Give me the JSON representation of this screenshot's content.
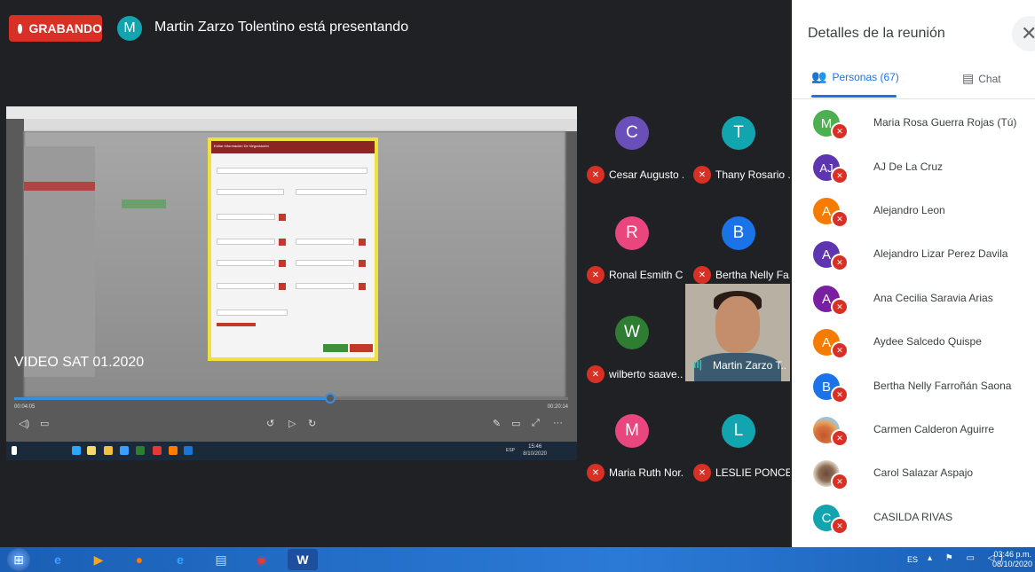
{
  "meeting": {
    "recording_label": "GRABANDO",
    "presenter_initial": "M",
    "presenter_status": "Martin Zarzo Tolentino está presentando"
  },
  "shared_screen": {
    "video_title": "VIDEO SAT 01.2020",
    "modal_title": "Editar Información De Negociación",
    "time_current": "00:04:05",
    "time_total": "00:20:14",
    "progress": 0.57,
    "taskbar_lang": "ESP",
    "taskbar_time": "15:46",
    "taskbar_date": "8/10/2020"
  },
  "participants": [
    {
      "initial": "C",
      "name": "Cesar Augusto ...",
      "color": "#6b4fb8"
    },
    {
      "initial": "T",
      "name": "Thany Rosario ...",
      "color": "#12a4af"
    },
    {
      "initial": "R",
      "name": "Ronal Esmith C...",
      "color": "#e8467c"
    },
    {
      "initial": "B",
      "name": "Bertha Nelly Fa...",
      "color": "#1a73e8"
    },
    {
      "initial": "W",
      "name": "wilberto saave...",
      "color": "#2e7d32"
    },
    {
      "initial": "",
      "name": "Martin Zarzo T...",
      "color": ""
    },
    {
      "initial": "M",
      "name": "Maria Ruth Nor...",
      "color": "#e8467c"
    },
    {
      "initial": "L",
      "name": "LESLIE PONCE...",
      "color": "#12a4af"
    }
  ],
  "panel": {
    "title": "Detalles de la reunión",
    "tab_people": "Personas (67)",
    "tab_chat": "Chat",
    "people": [
      {
        "initial": "M",
        "name": "Maria Rosa Guerra Rojas (Tú)",
        "color": "#4caf50",
        "photo": ""
      },
      {
        "initial": "AJ",
        "name": "AJ De La Cruz",
        "color": "#5e35b1",
        "photo": ""
      },
      {
        "initial": "A",
        "name": "Alejandro Leon",
        "color": "#f57c00",
        "photo": ""
      },
      {
        "initial": "A",
        "name": "Alejandro Lizar Perez Davila",
        "color": "#5e35b1",
        "photo": ""
      },
      {
        "initial": "A",
        "name": "Ana Cecilia Saravia Arias",
        "color": "#7b1fa2",
        "photo": ""
      },
      {
        "initial": "A",
        "name": "Aydee Salcedo Quispe",
        "color": "#f57c00",
        "photo": ""
      },
      {
        "initial": "B",
        "name": "Bertha Nelly Farroñán Saona",
        "color": "#1a73e8",
        "photo": ""
      },
      {
        "initial": "",
        "name": "Carmen Calderon Aguirre",
        "color": "",
        "photo": "rock"
      },
      {
        "initial": "",
        "name": "Carol Salazar Aspajo",
        "color": "",
        "photo": "face"
      },
      {
        "initial": "C",
        "name": "CASILDA RIVAS",
        "color": "#12a4af",
        "photo": ""
      }
    ]
  },
  "taskbar": {
    "lang": "ES",
    "time": "03:46 p.m.",
    "date": "08/10/2020",
    "apps": [
      {
        "icon": "internet-explorer-icon",
        "glyph": "e",
        "color": "#3aa0ff"
      },
      {
        "icon": "media-player-icon",
        "glyph": "▶",
        "color": "#f5a623"
      },
      {
        "icon": "firefox-icon",
        "glyph": "●",
        "color": "#ff7a00"
      },
      {
        "icon": "edge-icon",
        "glyph": "e",
        "color": "#2aa8ff"
      },
      {
        "icon": "file-explorer-icon",
        "glyph": "▤",
        "color": "#f5d76e"
      },
      {
        "icon": "chrome-icon",
        "glyph": "◉",
        "color": "#e53935"
      },
      {
        "icon": "word-icon",
        "glyph": "W",
        "color": "#ffffff"
      }
    ]
  }
}
